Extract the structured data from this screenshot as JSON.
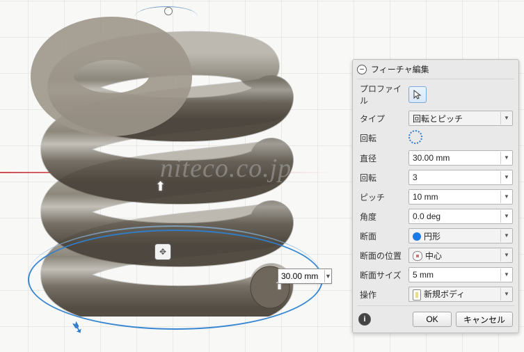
{
  "watermark": "niteco.co.jp",
  "inline_dim": {
    "value": "30.00 mm"
  },
  "panel": {
    "title": "フィーチャ編集",
    "profile_label": "プロファイル",
    "type_label": "タイプ",
    "type_value": "回転とピッチ",
    "rotation_label": "回転",
    "diameter_label": "直径",
    "diameter_value": "30.00 mm",
    "revolutions_label": "回転",
    "revolutions_value": "3",
    "pitch_label": "ピッチ",
    "pitch_value": "10 mm",
    "angle_label": "角度",
    "angle_value": "0.0 deg",
    "section_label": "断面",
    "section_value": "円形",
    "section_pos_label": "断面の位置",
    "section_pos_value": "中心",
    "section_size_label": "断面サイズ",
    "section_size_value": "5 mm",
    "operation_label": "操作",
    "operation_value": "新規ボディ",
    "ok": "OK",
    "cancel": "キャンセル"
  }
}
